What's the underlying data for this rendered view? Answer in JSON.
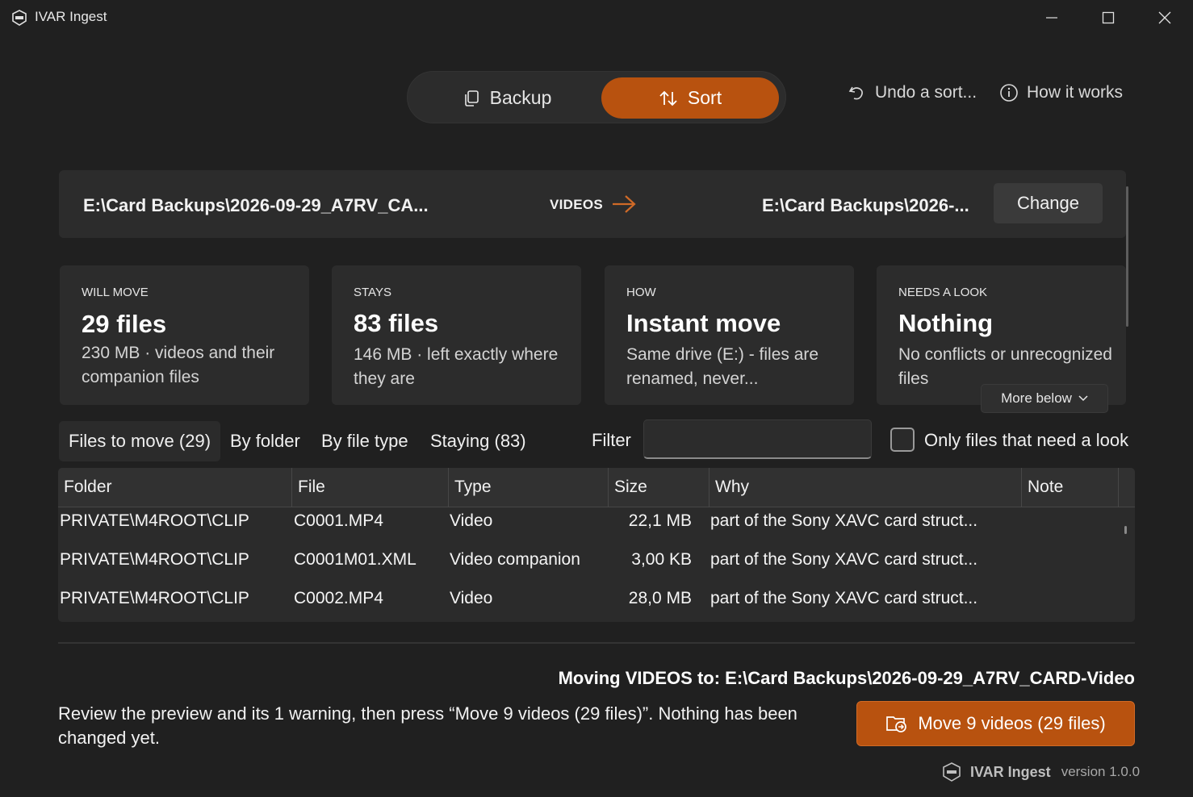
{
  "window": {
    "title": "IVAR Ingest"
  },
  "mode_switch": {
    "backup_label": "Backup",
    "sort_label": "Sort",
    "active": "Sort"
  },
  "header_links": {
    "undo_label": "Undo a sort...",
    "how_label": "How it works"
  },
  "path_bar": {
    "source": "E:\\Card Backups\\2026-09-29_A7RV_CA...",
    "category": "VIDEOS",
    "destination": "E:\\Card Backups\\2026-...",
    "change_label": "Change"
  },
  "cards": [
    {
      "kicker": "WILL MOVE",
      "headline": "29 files",
      "detail": "230 MB  ·  videos and their companion files"
    },
    {
      "kicker": "STAYS",
      "headline": "83 files",
      "detail": "146 MB  ·  left exactly where they are"
    },
    {
      "kicker": "HOW",
      "headline": "Instant move",
      "detail": "Same drive (E:) - files are renamed, never..."
    },
    {
      "kicker": "NEEDS A LOOK",
      "headline": "Nothing",
      "detail": "No conflicts or unrecognized files"
    }
  ],
  "more_below_label": "More below",
  "tabs": {
    "files_to_move": "Files to move (29)",
    "by_folder": "By folder",
    "by_file_type": "By file type",
    "staying": "Staying (83)"
  },
  "filter": {
    "label": "Filter",
    "value": "",
    "placeholder": ""
  },
  "only_look": {
    "label": "Only files that need a look",
    "checked": false
  },
  "table": {
    "headers": [
      "Folder",
      "File",
      "Type",
      "Size",
      "Why",
      "Note"
    ],
    "rows": [
      {
        "folder": "PRIVATE\\M4ROOT\\CLIP",
        "file": "C0001.MP4",
        "type": "Video",
        "size": "22,1 MB",
        "why": "part of the Sony XAVC card struct...",
        "note": ""
      },
      {
        "folder": "PRIVATE\\M4ROOT\\CLIP",
        "file": "C0001M01.XML",
        "type": "Video companion",
        "size": "3,00 KB",
        "why": "part of the Sony XAVC card struct...",
        "note": ""
      },
      {
        "folder": "PRIVATE\\M4ROOT\\CLIP",
        "file": "C0002.MP4",
        "type": "Video",
        "size": "28,0 MB",
        "why": "part of the Sony XAVC card struct...",
        "note": ""
      }
    ]
  },
  "moving_to": "Moving VIDEOS to: E:\\Card Backups\\2026-09-29_A7RV_CARD-Video",
  "review_text": "Review the preview and its 1 warning, then press “Move 9 videos (29 files)”. Nothing has been changed yet.",
  "move_button_label": "Move 9 videos (29 files)",
  "footer": {
    "app_name": "IVAR Ingest",
    "version": "version 1.0.0"
  },
  "colors": {
    "accent": "#b8520f",
    "background": "#202020",
    "surface": "#2c2c2c"
  }
}
